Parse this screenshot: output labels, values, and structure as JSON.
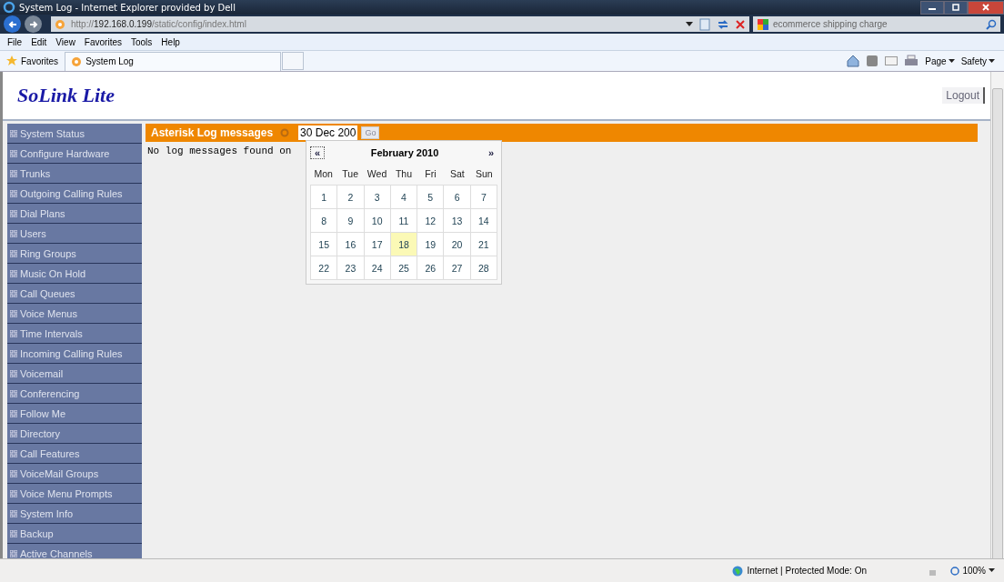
{
  "window": {
    "title": "System Log - Internet Explorer provided by Dell"
  },
  "address_bar": {
    "url_prefix": "http://",
    "url_host": "192.168.0.199",
    "url_path": "/static/config/index.html"
  },
  "search": {
    "value": "ecommerce shipping charge"
  },
  "menu": [
    "File",
    "Edit",
    "View",
    "Favorites",
    "Tools",
    "Help"
  ],
  "favorites_bar": {
    "favorites": "Favorites",
    "tab": "System Log",
    "commands": [
      "Page",
      "Safety"
    ]
  },
  "page": {
    "logo": "SoLink Lite",
    "logout": "Logout",
    "sidebar": [
      {
        "label": "System Status"
      },
      {
        "label": "Configure Hardware"
      },
      {
        "label": "Trunks"
      },
      {
        "label": "Outgoing Calling Rules"
      },
      {
        "label": "Dial Plans"
      },
      {
        "label": "Users"
      },
      {
        "label": "Ring Groups"
      },
      {
        "label": "Music On Hold"
      },
      {
        "label": "Call Queues"
      },
      {
        "label": "Voice Menus"
      },
      {
        "label": "Time Intervals"
      },
      {
        "label": "Incoming Calling Rules"
      },
      {
        "label": "Voicemail"
      },
      {
        "label": "Conferencing"
      },
      {
        "label": "Follow Me"
      },
      {
        "label": "Directory"
      },
      {
        "label": "Call Features"
      },
      {
        "label": "VoiceMail Groups"
      },
      {
        "label": "Voice Menu Prompts"
      },
      {
        "label": "System Info"
      },
      {
        "label": "Backup"
      },
      {
        "label": "Active Channels"
      }
    ],
    "panel": {
      "title": "Asterisk Log messages",
      "date": "30 Dec 200",
      "go": "Go",
      "message": "No log messages found on"
    },
    "calendar": {
      "prev": "«",
      "month": "February 2010",
      "next": "»",
      "weekdays": [
        "Mon",
        "Tue",
        "Wed",
        "Thu",
        "Fri",
        "Sat",
        "Sun"
      ],
      "days": [
        {
          "day": "1",
          "selected": false
        },
        {
          "day": "2",
          "selected": false
        },
        {
          "day": "3",
          "selected": false
        },
        {
          "day": "4",
          "selected": false
        },
        {
          "day": "5",
          "selected": false
        },
        {
          "day": "6",
          "selected": false
        },
        {
          "day": "7",
          "selected": false
        },
        {
          "day": "8",
          "selected": false
        },
        {
          "day": "9",
          "selected": false
        },
        {
          "day": "10",
          "selected": false
        },
        {
          "day": "11",
          "selected": false
        },
        {
          "day": "12",
          "selected": false
        },
        {
          "day": "13",
          "selected": false
        },
        {
          "day": "14",
          "selected": false
        },
        {
          "day": "15",
          "selected": false
        },
        {
          "day": "16",
          "selected": false
        },
        {
          "day": "17",
          "selected": false
        },
        {
          "day": "18",
          "selected": true
        },
        {
          "day": "19",
          "selected": false
        },
        {
          "day": "20",
          "selected": false
        },
        {
          "day": "21",
          "selected": false
        },
        {
          "day": "22",
          "selected": false
        },
        {
          "day": "23",
          "selected": false
        },
        {
          "day": "24",
          "selected": false
        },
        {
          "day": "25",
          "selected": false
        },
        {
          "day": "26",
          "selected": false
        },
        {
          "day": "27",
          "selected": false
        },
        {
          "day": "28",
          "selected": false
        }
      ]
    }
  },
  "status_bar": {
    "zone": "Internet | Protected Mode: On",
    "zoom": "100%"
  }
}
